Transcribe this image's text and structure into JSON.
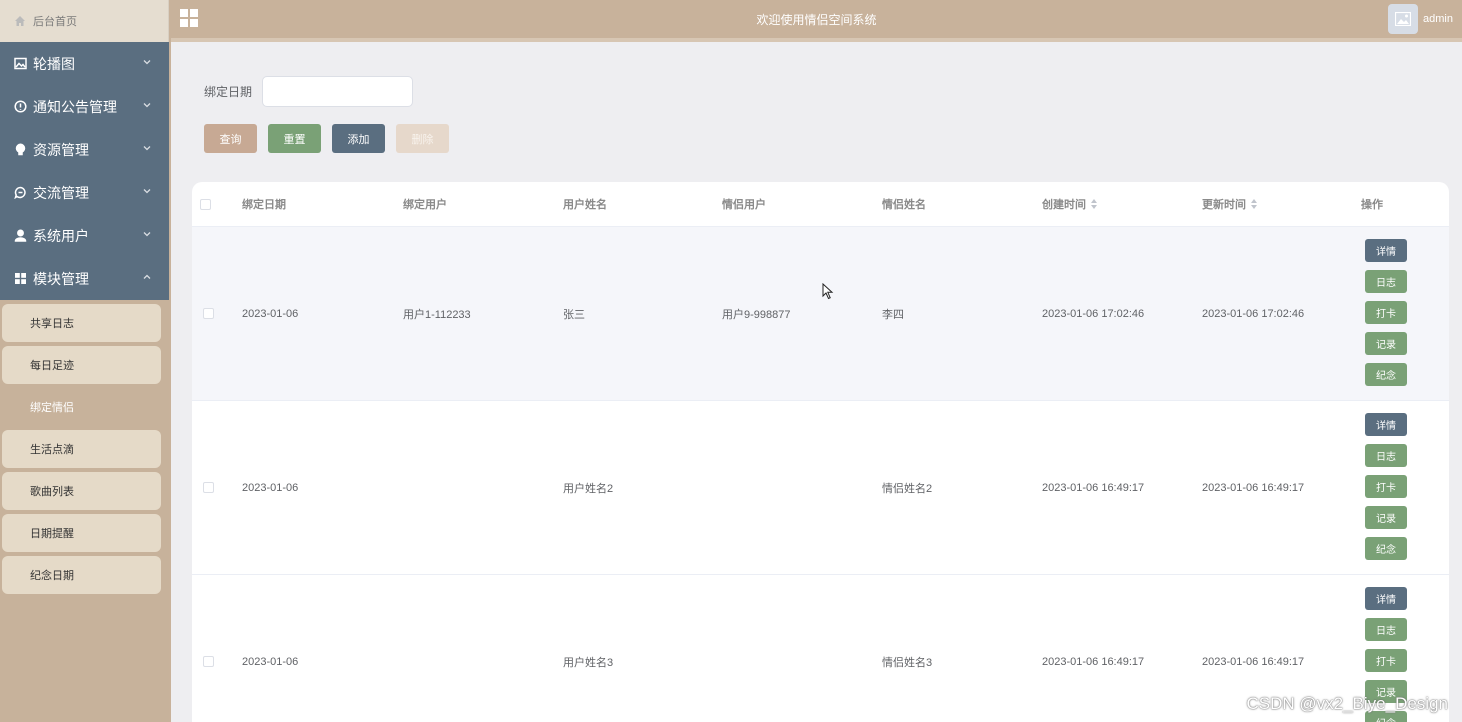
{
  "sidebar": {
    "home_label": "后台首页",
    "items": [
      {
        "label": "轮播图",
        "icon": "picture-icon"
      },
      {
        "label": "通知公告管理",
        "icon": "info-icon"
      },
      {
        "label": "资源管理",
        "icon": "bulb-icon"
      },
      {
        "label": "交流管理",
        "icon": "chat-icon"
      },
      {
        "label": "系统用户",
        "icon": "user-icon"
      },
      {
        "label": "模块管理",
        "icon": "grid-icon"
      }
    ],
    "subitems": [
      "共享日志",
      "每日足迹",
      "绑定情侣",
      "生活点滴",
      "歌曲列表",
      "日期提醒",
      "纪念日期"
    ],
    "active_subitem": "绑定情侣"
  },
  "topbar": {
    "title": "欢迎使用情侣空间系统",
    "username": "admin"
  },
  "search": {
    "label": "绑定日期",
    "value": "",
    "placeholder": ""
  },
  "buttons": {
    "query": "查询",
    "reset": "重置",
    "add": "添加",
    "delete": "删除"
  },
  "table": {
    "headers": [
      "绑定日期",
      "绑定用户",
      "用户姓名",
      "情侣用户",
      "情侣姓名",
      "创建时间",
      "更新时间",
      "操作"
    ],
    "rows": [
      [
        "2023-01-06",
        "用户1-112233",
        "张三",
        "用户9-998877",
        "李四",
        "2023-01-06 17:02:46",
        "2023-01-06 17:02:46"
      ],
      [
        "2023-01-06",
        "",
        "用户姓名2",
        "",
        "情侣姓名2",
        "2023-01-06 16:49:17",
        "2023-01-06 16:49:17"
      ],
      [
        "2023-01-06",
        "",
        "用户姓名3",
        "",
        "情侣姓名3",
        "2023-01-06 16:49:17",
        "2023-01-06 16:49:17"
      ]
    ],
    "row_actions": [
      "详情",
      "日志",
      "打卡",
      "记录",
      "纪念"
    ]
  },
  "watermark": "CSDN @vx2_Biye_Design",
  "colors": {
    "sidebar_menu": "#5a6e80",
    "accent_tan": "#c8b29b",
    "green": "#7aa176"
  }
}
